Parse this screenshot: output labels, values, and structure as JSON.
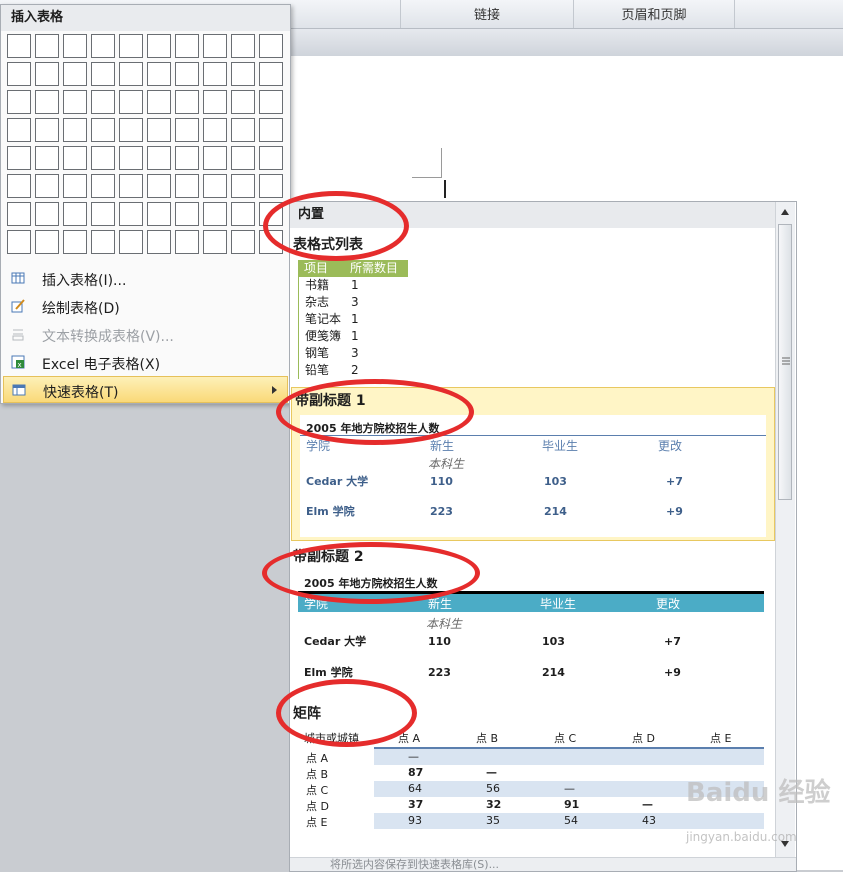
{
  "ribbon": {
    "tab_link": "链接",
    "tab_header_footer": "页眉和页脚"
  },
  "insert_menu": {
    "title": "插入表格",
    "items": [
      {
        "label": "插入表格(I)...",
        "icon": "table-icon",
        "state": "normal"
      },
      {
        "label": "绘制表格(D)",
        "icon": "pencil-table-icon",
        "state": "normal"
      },
      {
        "label": "文本转换成表格(V)...",
        "icon": "text-to-table-icon",
        "state": "disabled"
      },
      {
        "label": "Excel 电子表格(X)",
        "icon": "excel-icon",
        "state": "normal"
      },
      {
        "label": "快速表格(T)",
        "icon": "quick-table-icon",
        "state": "hover"
      }
    ]
  },
  "gallery": {
    "section_builtin": "内置",
    "tabular_list": {
      "title": "表格式列表",
      "header": [
        "项目",
        "所需数目"
      ],
      "rows": [
        [
          "书籍",
          "1"
        ],
        [
          "杂志",
          "3"
        ],
        [
          "笔记本",
          "1"
        ],
        [
          "便笺簿",
          "1"
        ],
        [
          "钢笔",
          "3"
        ],
        [
          "铅笔",
          "2"
        ]
      ]
    },
    "double_table_1": {
      "title": "带副标题 1",
      "caption": "2005 年地方院校招生人数",
      "headers": [
        "学院",
        "新生",
        "毕业生",
        "更改"
      ],
      "subheader": "本科生",
      "rows": [
        [
          "Cedar 大学",
          "110",
          "103",
          "+7"
        ],
        [
          "Elm 学院",
          "223",
          "214",
          "+9"
        ]
      ]
    },
    "double_table_2": {
      "title": "带副标题 2",
      "caption": "2005 年地方院校招生人数",
      "headers": [
        "学院",
        "新生",
        "毕业生",
        "更改"
      ],
      "subheader": "本科生",
      "rows": [
        [
          "Cedar 大学",
          "110",
          "103",
          "+7"
        ],
        [
          "Elm 学院",
          "223",
          "214",
          "+9"
        ]
      ]
    },
    "matrix": {
      "title": "矩阵",
      "corner": "城市或城镇",
      "cols": [
        "点 A",
        "点 B",
        "点 C",
        "点 D",
        "点 E"
      ],
      "rows": [
        {
          "label": "点 A",
          "vals": [
            "—",
            "",
            "",
            "",
            ""
          ]
        },
        {
          "label": "点 B",
          "vals": [
            "87",
            "—",
            "",
            "",
            ""
          ]
        },
        {
          "label": "点 C",
          "vals": [
            "64",
            "56",
            "—",
            "",
            ""
          ]
        },
        {
          "label": "点 D",
          "vals": [
            "37",
            "32",
            "91",
            "—",
            ""
          ]
        },
        {
          "label": "点 E",
          "vals": [
            "93",
            "35",
            "54",
            "43",
            ""
          ]
        }
      ]
    },
    "footer_label": "将所选内容保存到快速表格库(S)..."
  },
  "watermark": {
    "text": "Baidu 经验",
    "sub": "jingyan.baidu.com"
  },
  "colors": {
    "green_header": "#9bbb59",
    "blue_header": "#4bacc6",
    "highlight": "#fff5c6",
    "annotation_red": "#e52c2c"
  }
}
